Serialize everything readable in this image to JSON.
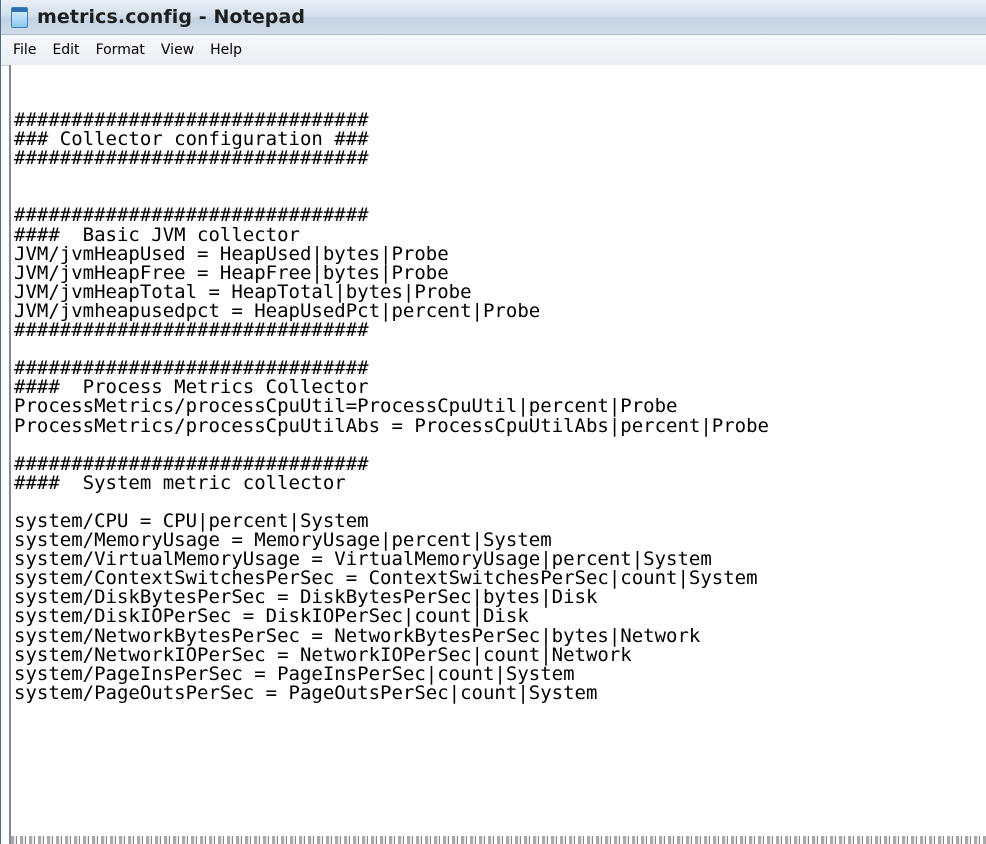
{
  "window": {
    "title": "metrics.config - Notepad"
  },
  "menu": {
    "items": [
      {
        "label": "File"
      },
      {
        "label": "Edit"
      },
      {
        "label": "Format"
      },
      {
        "label": "View"
      },
      {
        "label": "Help"
      }
    ]
  },
  "editor": {
    "lines": [
      "###############################",
      "### Collector configuration ###",
      "###############################",
      "",
      "",
      "###############################",
      "####  Basic JVM collector",
      "JVM/jvmHeapUsed = HeapUsed|bytes|Probe",
      "JVM/jvmHeapFree = HeapFree|bytes|Probe",
      "JVM/jvmHeapTotal = HeapTotal|bytes|Probe",
      "JVM/jvmheapusedpct = HeapUsedPct|percent|Probe",
      "###############################",
      "",
      "###############################",
      "####  Process Metrics Collector",
      "ProcessMetrics/processCpuUtil=ProcessCpuUtil|percent|Probe",
      "ProcessMetrics/processCpuUtilAbs = ProcessCpuUtilAbs|percent|Probe",
      "",
      "###############################",
      "####  System metric collector",
      "",
      "system/CPU = CPU|percent|System",
      "system/MemoryUsage = MemoryUsage|percent|System",
      "system/VirtualMemoryUsage = VirtualMemoryUsage|percent|System",
      "system/ContextSwitchesPerSec = ContextSwitchesPerSec|count|System",
      "system/DiskBytesPerSec = DiskBytesPerSec|bytes|Disk",
      "system/DiskIOPerSec = DiskIOPerSec|count|Disk",
      "system/NetworkBytesPerSec = NetworkBytesPerSec|bytes|Network",
      "system/NetworkIOPerSec = NetworkIOPerSec|count|Network",
      "system/PageInsPerSec = PageInsPerSec|count|System",
      "system/PageOutsPerSec = PageOutsPerSec|count|System"
    ]
  }
}
